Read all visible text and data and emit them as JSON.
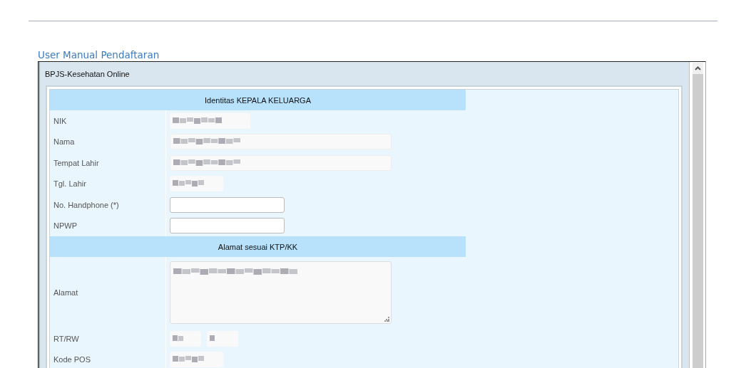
{
  "section_title": "User Manual Pendaftaran",
  "frame": {
    "title": "BPJS-Kesehatan Online"
  },
  "form": [
    {
      "kind": "header",
      "label": "Identitas KEPALA KELUARGA"
    },
    {
      "kind": "plain",
      "label": "NIK"
    },
    {
      "kind": "box",
      "label": "Nama"
    },
    {
      "kind": "box",
      "label": "Tempat Lahir"
    },
    {
      "kind": "short",
      "label": "Tgl. Lahir"
    },
    {
      "kind": "input",
      "label": "No. Handphone (*)"
    },
    {
      "kind": "input",
      "label": "NPWP"
    },
    {
      "kind": "header",
      "label": "Alamat sesuai KTP/KK"
    },
    {
      "kind": "textarea",
      "label": "Alamat"
    },
    {
      "kind": "pair",
      "label": "RT/RW"
    },
    {
      "kind": "short",
      "label": "Kode POS"
    }
  ]
}
